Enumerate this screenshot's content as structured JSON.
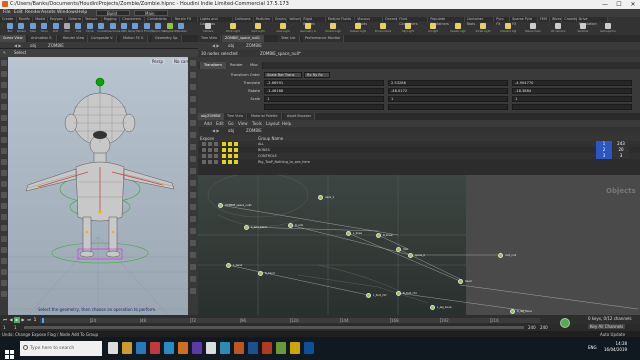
{
  "window": {
    "title": "C:/Users/Banks/Documents/HoudiniProjects/Zombie/Zombie.hipnc - Houdini Indie Limited-Commercial 17.5.173",
    "controls": [
      "—",
      "☐",
      "✕"
    ]
  },
  "menu": {
    "items": [
      "File",
      "Edit",
      "Render",
      "Assets",
      "Windows",
      "Help"
    ],
    "build": "Build",
    "main": "Main"
  },
  "shelf": {
    "tabs": [
      "Create",
      "Modify",
      "Model",
      "Polygon",
      "Deform",
      "Texture",
      "Rigging",
      "Characters",
      "Constraints",
      "Guide Process",
      "Guide Brushes",
      "Terrain FX",
      "Cloud FX",
      "Volume"
    ],
    "right_tabs": [
      "Lights and Cameras",
      "Collisions",
      "Particles",
      "Grains",
      "Vellum",
      "Rigid Bodies",
      "Particle Fluids",
      "Viscous Fluids",
      "Oceans",
      "Fluid Containers",
      "Populate Containers",
      "Container Tools",
      "Pyro FX",
      "Sparse Pyro FX",
      "FEM",
      "Wires",
      "Crowds",
      "Drive Simulation"
    ],
    "tools": [
      {
        "label": "Box",
        "color": "#6a9fd8"
      },
      {
        "label": "Sphere",
        "color": "#6a9fd8"
      },
      {
        "label": "Tube",
        "color": "#6a9fd8"
      },
      {
        "label": "Torus",
        "color": "#6a9fd8"
      },
      {
        "label": "Grid",
        "color": "#6a9fd8"
      },
      {
        "label": "Null",
        "color": "#aaaaaa"
      },
      {
        "label": "Line",
        "color": "#6a9fd8"
      },
      {
        "label": "Circle",
        "color": "#6a9fd8"
      },
      {
        "label": "Curve",
        "color": "#6a9fd8"
      },
      {
        "label": "Draw Curve",
        "color": "#6a9fd8"
      },
      {
        "label": "Path",
        "color": "#6a9fd8"
      },
      {
        "label": "Spray Paint",
        "color": "#6a9fd8"
      },
      {
        "label": "Font",
        "color": "#6a9fd8"
      },
      {
        "label": "Platonic Solids",
        "color": "#6a9fd8"
      },
      {
        "label": "L-System",
        "color": "#8dc63f"
      },
      {
        "label": "Metaball",
        "color": "#6a9fd8"
      },
      {
        "label": "File",
        "color": "#d8b86a"
      }
    ],
    "right_tools": [
      {
        "label": "Camera",
        "color": "#cccccc"
      },
      {
        "label": "Point Light",
        "color": "#e8d060"
      },
      {
        "label": "Spot Light",
        "color": "#e8d060"
      },
      {
        "label": "Area Light",
        "color": "#e8d060"
      },
      {
        "label": "Geometry Light",
        "color": "#e8d060"
      },
      {
        "label": "Volume Light",
        "color": "#e8d060"
      },
      {
        "label": "Distant Light",
        "color": "#e8d060"
      },
      {
        "label": "Environment Light",
        "color": "#e8d060"
      },
      {
        "label": "Sky Light",
        "color": "#e8d060"
      },
      {
        "label": "GI Light",
        "color": "#e8d060"
      },
      {
        "label": "Caustic Light",
        "color": "#e8d060"
      },
      {
        "label": "Portal Light",
        "color": "#e8d060"
      },
      {
        "label": "Ambient Light",
        "color": "#e8d060"
      },
      {
        "label": "Stereo Camera",
        "color": "#cccccc"
      },
      {
        "label": "VR Camera",
        "color": "#cccccc"
      },
      {
        "label": "Switcher",
        "color": "#cccccc"
      },
      {
        "label": "Gamepad Camera",
        "color": "#cccccc"
      }
    ]
  },
  "viewport": {
    "tabs": [
      "Scene View",
      "Animation E.",
      "Render View",
      "Composite V.",
      "Motion FX V.",
      "Geometry Sp."
    ],
    "path": "obj",
    "node": "ZOMBIE",
    "mode": "Select",
    "persp": "Persp",
    "cam": "No cam",
    "message": "Select the geometry, then choose an operation to perform."
  },
  "params": {
    "tabs": [
      "Tree View",
      "ZOMBIE_space_null1",
      "Take List",
      "Performance Monitor"
    ],
    "path": "obj",
    "node": "ZOMBIE",
    "selected": "30 nodes selected",
    "head_label": "ZOMBIE_space_null*",
    "folders": [
      "Transform",
      "Render",
      "Misc"
    ],
    "transform_order": "Scale Rot Trans",
    "rot_order": "Rx Ry Rz",
    "rows": [
      {
        "label": "Transform Order",
        "values": []
      },
      {
        "label": "Translate",
        "values": [
          "-2.66591",
          "2.53286",
          "-4.904770"
        ]
      },
      {
        "label": "Rotate",
        "values": [
          "-1.46168",
          "-48.0172",
          "-18.3884"
        ]
      },
      {
        "label": "Scale",
        "values": [
          "1",
          "1",
          "1"
        ]
      },
      {
        "label": "",
        "values": [
          "",
          "",
          ""
        ]
      }
    ]
  },
  "channels": {
    "tabs": [
      "obj/ZOMBIE",
      "Tree View",
      "Material Palette",
      "Asset Browser"
    ],
    "menu": [
      "Add",
      "Edit",
      "Go",
      "View",
      "Tools",
      "Layout",
      "Help"
    ],
    "path": "obj",
    "node": "ZOMBIE",
    "header": [
      "Expose",
      "Group Name"
    ],
    "groups": [
      {
        "name": "ALL",
        "color": "#e8d018"
      },
      {
        "name": "BONES",
        "color": "#e8d018"
      },
      {
        "name": "CONTROLS",
        "color": "#e8d018"
      },
      {
        "name": "Rig_TooP_Nothing_to_see_here",
        "color": "#e8d018"
      }
    ],
    "numbers": [
      "1",
      "243",
      "2",
      "20",
      "3",
      "3"
    ]
  },
  "network": {
    "label": "Objects",
    "nodes": [
      {
        "label": "ZOMBIE_space_null1"
      },
      {
        "label": "L_arm_bend"
      },
      {
        "label": "R_arm"
      },
      {
        "label": "L_knee"
      },
      {
        "label": "R_knee"
      },
      {
        "label": "hips"
      },
      {
        "label": "spine_2"
      },
      {
        "label": "neck_1"
      },
      {
        "label": "head"
      },
      {
        "label": "L_hand"
      },
      {
        "label": "R_hand"
      },
      {
        "label": "L_foot_ctrl"
      },
      {
        "label": "R_foot_ctrl"
      },
      {
        "label": "L_leg_bone"
      },
      {
        "label": "R_leg_bone"
      },
      {
        "label": "root_null"
      }
    ]
  },
  "timeline": {
    "start": "1",
    "current": "1",
    "end": "240",
    "end2": "240",
    "ticks": [
      "24",
      "48",
      "72",
      "96",
      "120",
      "144",
      "168",
      "192",
      "216"
    ],
    "keys_label": "0 keys, 0/12 channels",
    "key_all": "Key All Channels",
    "auto_update": "Auto Update",
    "status": "Undo: Change Expose Flag / Node Add To Group"
  },
  "taskbar": {
    "search": "Type here to search",
    "time": "14:28",
    "date": "16/04/2019",
    "lang": "ENG"
  }
}
